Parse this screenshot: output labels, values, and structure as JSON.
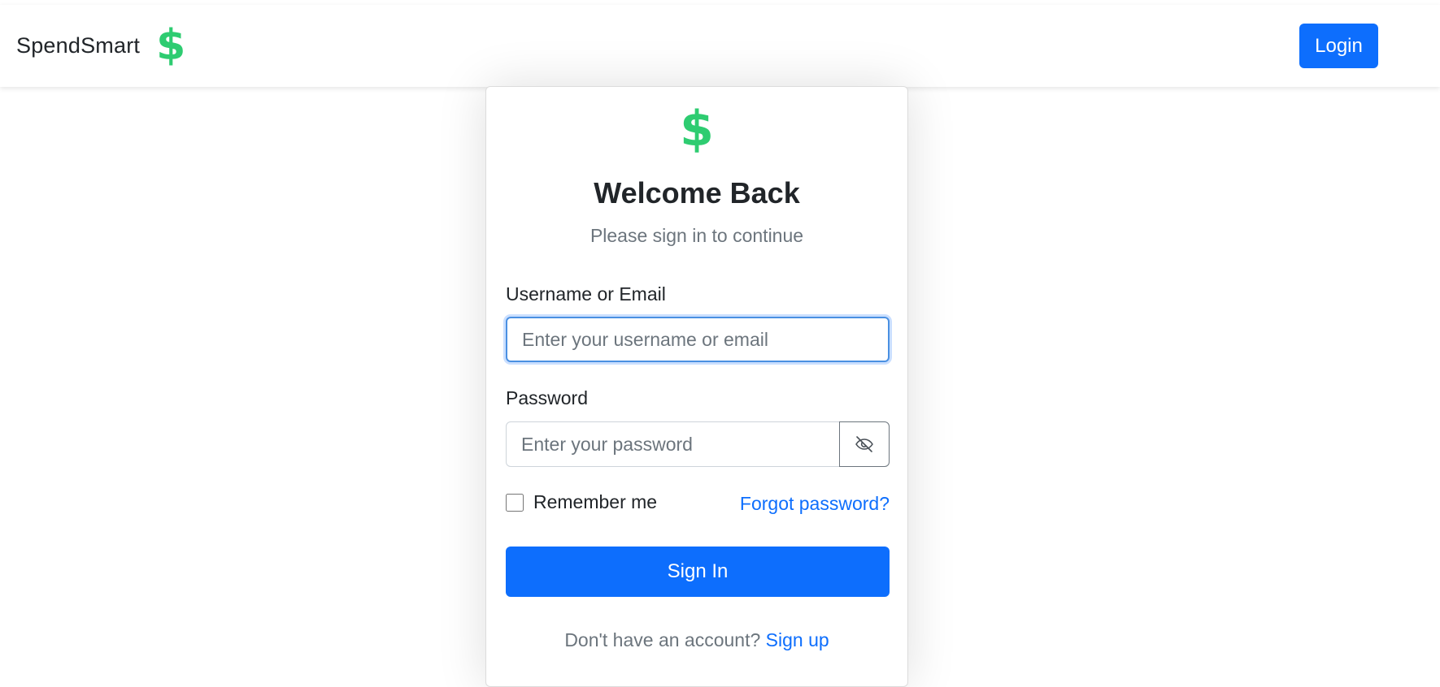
{
  "navbar": {
    "brand_name": "SpendSmart",
    "brand_icon": "$",
    "login_label": "Login"
  },
  "login_card": {
    "logo_icon": "$",
    "title": "Welcome Back",
    "subtitle": "Please sign in to continue",
    "username_label": "Username or Email",
    "username_placeholder": "Enter your username or email",
    "username_value": "",
    "password_label": "Password",
    "password_placeholder": "Enter your password",
    "password_value": "",
    "password_toggle_icon": "eye-slash-icon",
    "remember_label": "Remember me",
    "remember_checked": false,
    "forgot_label": "Forgot password?",
    "signin_label": "Sign In",
    "signup_prompt": "Don't have an account?",
    "signup_link": "Sign up"
  },
  "colors": {
    "primary": "#0d6efd",
    "brand_green": "#2ecc71",
    "muted_text": "#6c757d",
    "focus_border": "#4a90e2"
  }
}
